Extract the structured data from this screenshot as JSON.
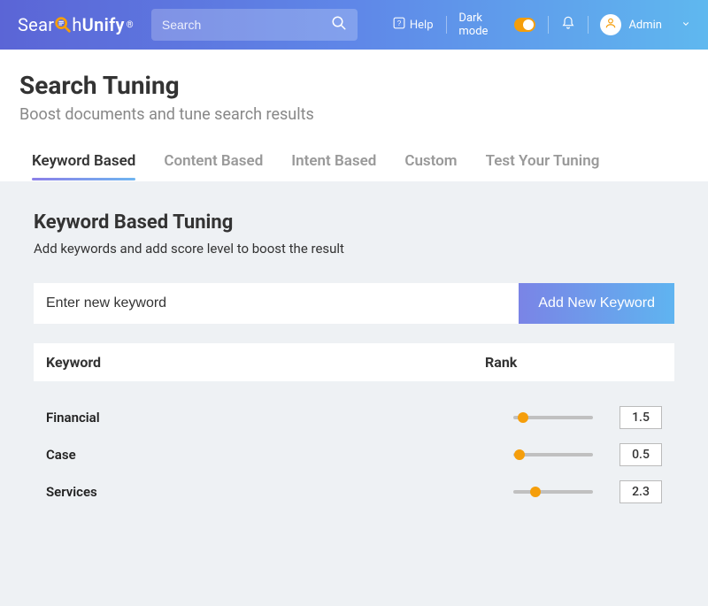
{
  "header": {
    "logo_prefix": "Sear",
    "logo_mid": "h",
    "logo_brand": "Unify",
    "search_placeholder": "Search",
    "help_label": "Help",
    "darkmode_label": "Dark mode",
    "user_label": "Admin"
  },
  "page": {
    "title": "Search Tuning",
    "subtitle": "Boost documents and tune search results"
  },
  "tabs": [
    {
      "label": "Keyword Based",
      "active": true
    },
    {
      "label": "Content Based",
      "active": false
    },
    {
      "label": "Intent Based",
      "active": false
    },
    {
      "label": "Custom",
      "active": false
    },
    {
      "label": "Test Your Tuning",
      "active": false
    }
  ],
  "section": {
    "title": "Keyword Based Tuning",
    "description": "Add keywords and add score level to boost the result",
    "input_placeholder": "Enter new keyword",
    "add_button": "Add New Keyword",
    "columns": {
      "keyword": "Keyword",
      "rank": "Rank"
    },
    "rows": [
      {
        "keyword": "Financial",
        "rank": "1.5",
        "slider_pct": 12
      },
      {
        "keyword": "Case",
        "rank": "0.5",
        "slider_pct": 8
      },
      {
        "keyword": "Services",
        "rank": "2.3",
        "slider_pct": 28
      }
    ]
  }
}
